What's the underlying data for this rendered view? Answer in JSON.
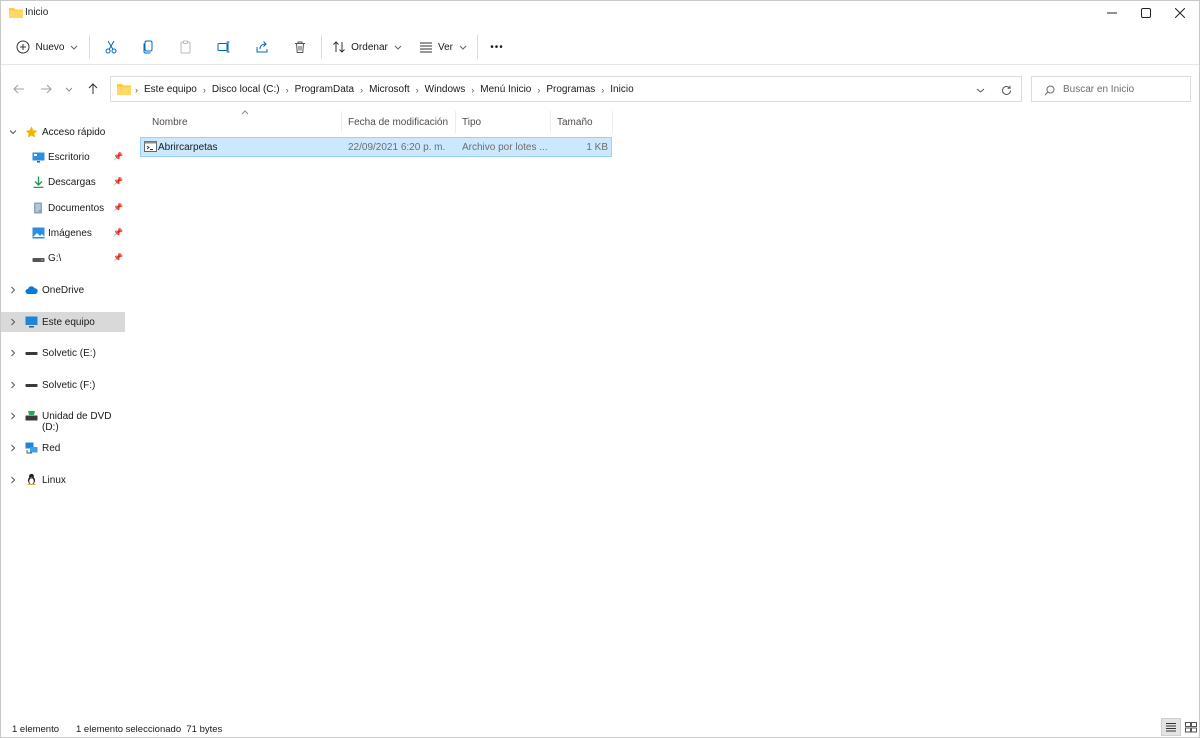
{
  "window": {
    "title": "Inicio",
    "controls": {
      "minimize": "─",
      "maximize": "☐",
      "close": "✕"
    }
  },
  "toolbar": {
    "new_label": "Nuevo",
    "sort_label": "Ordenar",
    "view_label": "Ver",
    "more_label": "•••"
  },
  "address": {
    "crumbs": [
      "Este equipo",
      "Disco local (C:)",
      "ProgramData",
      "Microsoft",
      "Windows",
      "Menú Inicio",
      "Programas",
      "Inicio"
    ]
  },
  "search": {
    "placeholder": "Buscar en Inicio"
  },
  "sidebar": {
    "quick_access": "Acceso rápido",
    "quick_items": [
      {
        "label": "Escritorio",
        "icon": "desktop-icon"
      },
      {
        "label": "Descargas",
        "icon": "download-icon"
      },
      {
        "label": "Documentos",
        "icon": "documents-icon"
      },
      {
        "label": "Imágenes",
        "icon": "pictures-icon"
      },
      {
        "label": "G:\\",
        "icon": "drive-icon"
      }
    ],
    "items": [
      {
        "label": "OneDrive",
        "icon": "cloud-icon"
      },
      {
        "label": "Este equipo",
        "icon": "computer-icon"
      },
      {
        "label": "Solvetic (E:)",
        "icon": "drive-icon"
      },
      {
        "label": "Solvetic (F:)",
        "icon": "drive-icon"
      },
      {
        "label": "Unidad de DVD (D:)",
        "icon": "dvd-icon"
      },
      {
        "label": "Red",
        "icon": "network-icon"
      },
      {
        "label": "Linux",
        "icon": "linux-icon"
      }
    ]
  },
  "columns": {
    "name": "Nombre",
    "modified": "Fecha de modificación",
    "type": "Tipo",
    "size": "Tamaño"
  },
  "files": [
    {
      "name": "Abrircarpetas",
      "modified": "22/09/2021 6:20 p. m.",
      "type": "Archivo por lotes ...",
      "size": "1 KB"
    }
  ],
  "status": {
    "count": "1 elemento",
    "selection": "1 elemento seleccionado  71 bytes"
  },
  "colors": {
    "accent": "#0067c0",
    "selection": "#cce8ff",
    "folder": "#ffc83d"
  }
}
